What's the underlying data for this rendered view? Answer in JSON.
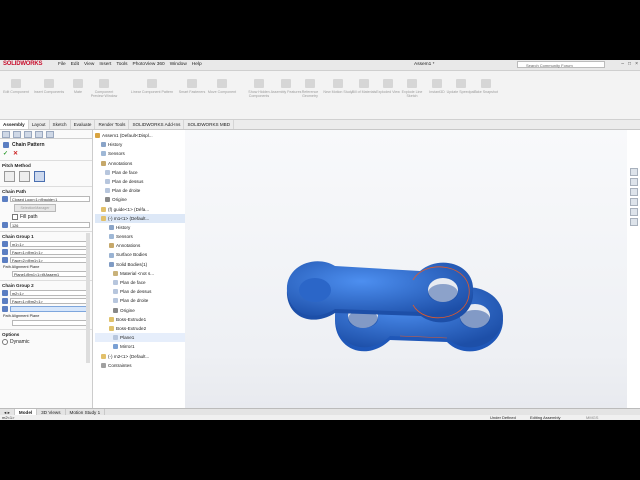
{
  "app": {
    "logo": "SOLIDWORKS",
    "menu": [
      "File",
      "Edit",
      "View",
      "Insert",
      "Tools",
      "PhotoView 360",
      "Window",
      "Help"
    ],
    "doc_title": "Assem1 *",
    "search_placeholder": "Search Community Forum"
  },
  "commands": [
    {
      "label": "Edit Component"
    },
    {
      "label": "Insert Components"
    },
    {
      "label": "Mate"
    },
    {
      "label": "Component Preview Window"
    },
    {
      "label": "Linear Component Pattern"
    },
    {
      "label": "Smart Fasteners"
    },
    {
      "label": "Move Component"
    },
    {
      "label": "Show Hidden Components"
    },
    {
      "label": "Assembly Features"
    },
    {
      "label": "Reference Geometry"
    },
    {
      "label": "New Motion Study"
    },
    {
      "label": "Bill of Materials"
    },
    {
      "label": "Exploded View"
    },
    {
      "label": "Explode Line Sketch"
    },
    {
      "label": "Instant3D"
    },
    {
      "label": "Update Speedpak"
    },
    {
      "label": "Take Snapshot"
    }
  ],
  "command_tabs": [
    "Assembly",
    "Layout",
    "Sketch",
    "Evaluate",
    "Render Tools",
    "SOLIDWORKS Add-Ins",
    "SOLIDWORKS MBD"
  ],
  "property_manager": {
    "title": "Chain Pattern",
    "pitch_method_label": "Pitch Method",
    "chain_path_label": "Chain Path",
    "chain_path_value": "Closed Loop<1>@guide<1",
    "path_button": "SelectionManager",
    "fill_path_label": "Fill path",
    "instances_value": "126",
    "group1_label": "Chain Group 1",
    "group1_component": "m1<1>",
    "group1_face1": "Face<1>@m1<1>",
    "group1_face2": "Face<2>@m1<1>",
    "group1_plane_label": "Path Alignment Plane",
    "group1_plane_value": "Plane1@m1<1>@Assem1",
    "group2_label": "Chain Group 2",
    "group2_component": "m2<1>",
    "group2_face1": "Face<1>@m2<1>",
    "group2_face2": "",
    "group2_plane_label": "Path Alignment Plane",
    "group2_plane_value": "",
    "options_label": "Options",
    "dynamic_label": "Dynamic"
  },
  "tree": [
    {
      "label": "Assem1 (Default<Displ..."
    },
    {
      "label": "History"
    },
    {
      "label": "Sensors"
    },
    {
      "label": "Annotations"
    },
    {
      "label": "Plan de face"
    },
    {
      "label": "Plan de dessus"
    },
    {
      "label": "Plan de droite"
    },
    {
      "label": "Origine"
    },
    {
      "label": "(f) guide<1> (Défa..."
    },
    {
      "label": "(-) m1<1> (Default..."
    },
    {
      "label": "History"
    },
    {
      "label": "Sensors"
    },
    {
      "label": "Annotations"
    },
    {
      "label": "Surface Bodies"
    },
    {
      "label": "Solid Bodies(1)"
    },
    {
      "label": "Material <not s..."
    },
    {
      "label": "Plan de face"
    },
    {
      "label": "Plan de dessus"
    },
    {
      "label": "Plan de droite"
    },
    {
      "label": "Origine"
    },
    {
      "label": "Boss-Extrude1"
    },
    {
      "label": "Boss-Extrude2"
    },
    {
      "label": "Plane1"
    },
    {
      "label": "Mirror1"
    },
    {
      "label": "(-) m2<1> (Default..."
    },
    {
      "label": "Contraintes"
    }
  ],
  "bottom_tabs": [
    "Model",
    "3D Views",
    "Motion Study 1"
  ],
  "status": {
    "left": "m2<1>",
    "constraint": "Under Defined",
    "mode": "Editing Assembly",
    "units": "MMGS"
  },
  "colors": {
    "part_blue": "#2f6fd4",
    "part_dark": "#1d4fa8",
    "highlight": "#e05a2b"
  }
}
